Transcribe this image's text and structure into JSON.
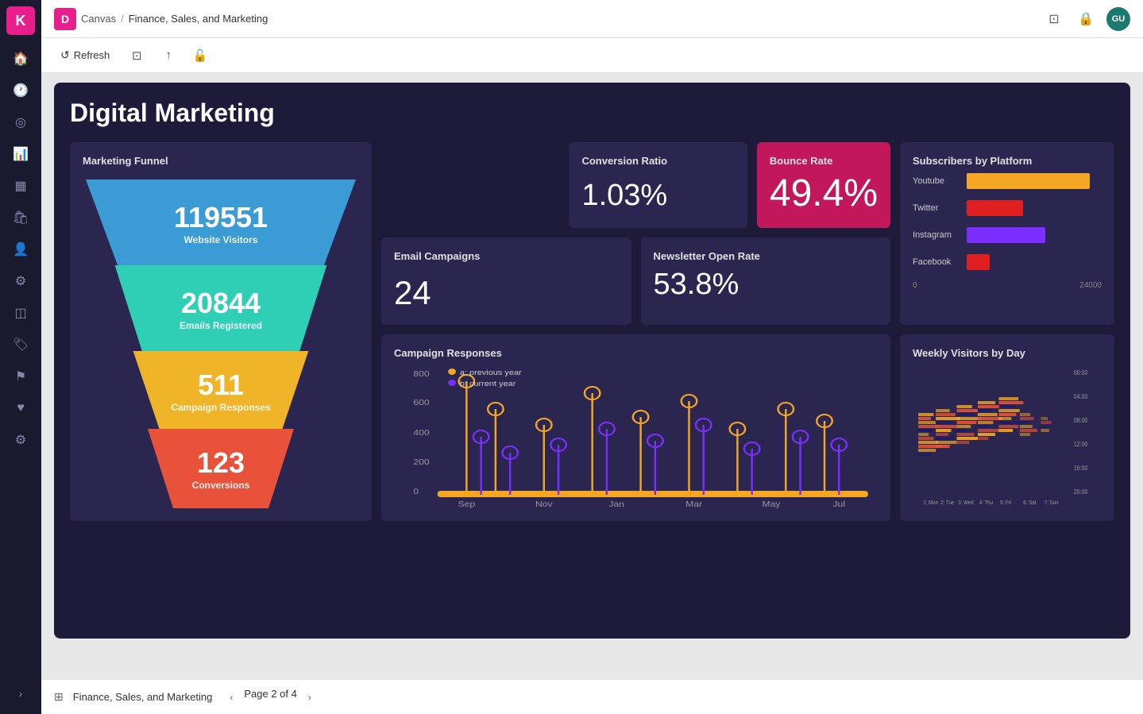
{
  "topbar": {
    "logo_text": "K",
    "brand_initial": "D",
    "breadcrumb_root": "Canvas",
    "breadcrumb_sep": "/",
    "breadcrumb_page": "Finance, Sales, and Marketing",
    "icon_monitor": "⊡",
    "icon_lock": "🔒",
    "avatar": "GU"
  },
  "toolbar": {
    "refresh_label": "Refresh",
    "icon_screenshot": "⊡",
    "icon_share": "↑",
    "icon_lock": "🔓"
  },
  "dashboard": {
    "title": "Digital Marketing",
    "funnel": {
      "title": "Marketing Funnel",
      "visitors_num": "119551",
      "visitors_label": "Website Visitors",
      "emails_num": "20844",
      "emails_label": "Emails Registered",
      "responses_num": "511",
      "responses_label": "Campaign Responses",
      "conversions_num": "123",
      "conversions_label": "Conversions"
    },
    "conversion_ratio": {
      "title": "Conversion Ratio",
      "value": "1.03%"
    },
    "bounce_rate": {
      "title": "Bounce Rate",
      "value": "49.4%"
    },
    "email_campaigns": {
      "title": "Email Campaigns",
      "value": "24"
    },
    "newsletter": {
      "title": "Newsletter Open Rate",
      "value": "53.8%"
    },
    "subscribers": {
      "title": "Subscribers by Platform",
      "max_label": "24000",
      "zero_label": "0",
      "platforms": [
        {
          "name": "Youtube",
          "value": 22000,
          "color": "#f5a623",
          "pct": 91
        },
        {
          "name": "Twitter",
          "value": 10000,
          "color": "#e02020",
          "pct": 42
        },
        {
          "name": "Instagram",
          "value": 14000,
          "color": "#7b2fff",
          "pct": 58
        },
        {
          "name": "Facebook",
          "value": 4000,
          "color": "#e02020",
          "pct": 17
        }
      ]
    },
    "campaign_responses": {
      "title": "Campaign Responses",
      "y_labels": [
        "800",
        "600",
        "400",
        "200",
        "0"
      ],
      "x_labels": [
        "Sep",
        "Nov",
        "Jan",
        "Mar",
        "May",
        "Jul"
      ],
      "legend_a": "a: previous year",
      "legend_b": "b: current year"
    },
    "weekly_visitors": {
      "title": "Weekly Visitors by Day",
      "y_labels": [
        "00:00",
        "04:00",
        "08:00",
        "12:00",
        "16:00",
        "20:00"
      ],
      "x_labels": [
        "1: Mon",
        "2: Tue",
        "3: Wed",
        "4: Thu",
        "5: Fri",
        "6: Sat",
        "7: Sun"
      ]
    }
  },
  "bottom_bar": {
    "icon": "⊞",
    "title": "Finance, Sales, and Marketing",
    "page_label": "Page 2 of 4",
    "prev_icon": "‹",
    "next_icon": "›"
  },
  "sidebar": {
    "items": [
      {
        "name": "home",
        "icon": "⊙"
      },
      {
        "name": "clock",
        "icon": "🕐"
      },
      {
        "name": "compass",
        "icon": "◎"
      },
      {
        "name": "chart",
        "icon": "📊"
      },
      {
        "name": "table",
        "icon": "▦"
      },
      {
        "name": "shop",
        "icon": "🛍"
      },
      {
        "name": "person",
        "icon": "👤"
      },
      {
        "name": "settings2",
        "icon": "⚙"
      },
      {
        "name": "layers",
        "icon": "◫"
      },
      {
        "name": "tag",
        "icon": "🏷"
      },
      {
        "name": "flag",
        "icon": "⚑"
      },
      {
        "name": "heart",
        "icon": "♥"
      },
      {
        "name": "gear",
        "icon": "⚙"
      }
    ],
    "collapse_icon": "›"
  }
}
